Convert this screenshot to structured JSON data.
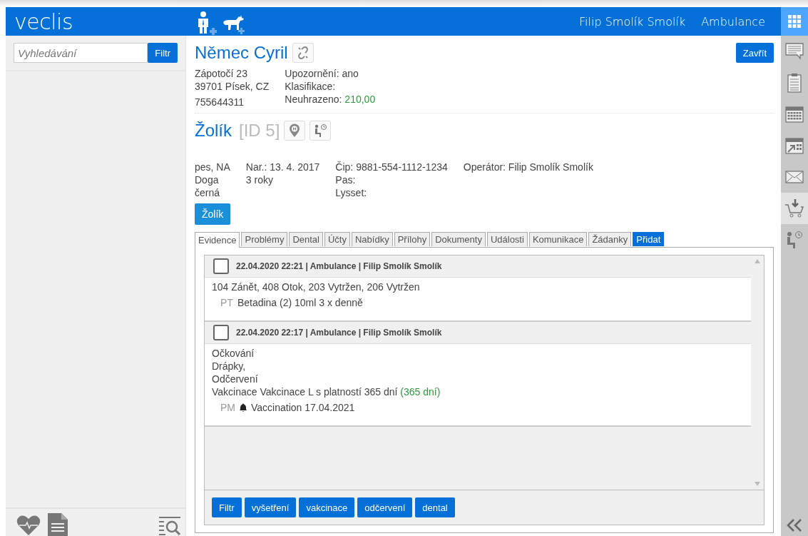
{
  "header": {
    "logo": "veclis",
    "user": "Filip Smolík Smolík",
    "clinic": "Ambulance"
  },
  "sidebar": {
    "search": {
      "placeholder": "Vyhledávání"
    },
    "filter_button": "Filtr"
  },
  "client": {
    "name": "Němec Cyril",
    "close_button": "Zavřít",
    "address": [
      "Zápotočí 23",
      "39701 Písek, CZ"
    ],
    "phone": "755644311",
    "warning": "Upozornění: ano",
    "classification": "Klasifikace:",
    "unpaid_label": "Neuhrazeno:",
    "unpaid_value": "210,00"
  },
  "patient": {
    "name": "Žolík",
    "id": "[ID 5]",
    "col1": [
      "pes, NA",
      "Doga",
      "černá"
    ],
    "col2": [
      "Nar.: 13. 4. 2017",
      "3 roky"
    ],
    "col3": [
      "Čip: 9881-554-1112-1234",
      "Pas:",
      "Lysset:"
    ],
    "operator": "Operátor: Filip Smolík Smolík",
    "patient_button": "Žolík"
  },
  "tabs": [
    {
      "label": "Evidence",
      "selected": true,
      "kind": "tab"
    },
    {
      "label": "Problémy",
      "selected": false,
      "kind": "tab"
    },
    {
      "label": "Dental",
      "selected": false,
      "kind": "tab"
    },
    {
      "label": "Účty",
      "selected": false,
      "kind": "tab"
    },
    {
      "label": "Nabídky",
      "selected": false,
      "kind": "tab"
    },
    {
      "label": "Přílohy",
      "selected": false,
      "kind": "tab"
    },
    {
      "label": "Dokumenty",
      "selected": false,
      "kind": "tab"
    },
    {
      "label": "Události",
      "selected": false,
      "kind": "tab"
    },
    {
      "label": "Komunikace",
      "selected": false,
      "kind": "tab"
    },
    {
      "label": "Žádanky",
      "selected": false,
      "kind": "tab"
    },
    {
      "label": "Přidat",
      "selected": false,
      "kind": "add"
    }
  ],
  "records": [
    {
      "header": "22.04.2020 22:21 | Ambulance | Filip Smolík Smolík",
      "checked": false,
      "lines": [
        {
          "text": "104 Zánět, 408 Otok, 203 Vytržen, 206 Vytržen"
        }
      ],
      "items": [
        {
          "code": "PT",
          "text": "Betadina (2) 10ml 3 x denně",
          "bell": false
        }
      ]
    },
    {
      "header": "22.04.2020 22:17 | Ambulance | Filip Smolík Smolík",
      "checked": false,
      "lines": [
        {
          "text": "Očkování"
        },
        {
          "text": "Drápky,"
        },
        {
          "text": "Odčervení"
        },
        {
          "text": "Vakcinace Vakcinace L s platností 365 dní",
          "note": "(365 dní)"
        }
      ],
      "items": [
        {
          "code": "PM",
          "text": "Vaccination 17.04.2021",
          "bell": true
        }
      ]
    }
  ],
  "filter_buttons": [
    "Filtr",
    "vyšetření",
    "vakcinace",
    "odčervení",
    "dental"
  ],
  "rail": [
    {
      "kind": "comment",
      "selected": false
    },
    {
      "kind": "clipboard",
      "selected": false
    },
    {
      "kind": "calendar",
      "selected": false
    },
    {
      "kind": "calendar-arrow",
      "selected": false
    },
    {
      "kind": "mail",
      "selected": false
    },
    {
      "kind": "cart",
      "selected": true
    },
    {
      "kind": "waiting",
      "selected": false
    }
  ]
}
